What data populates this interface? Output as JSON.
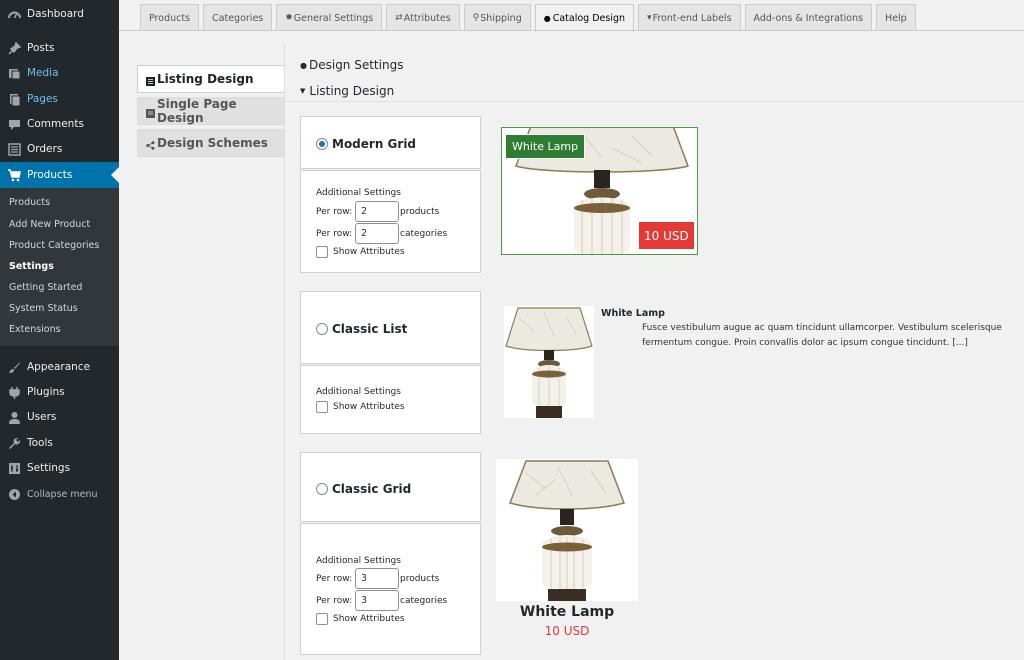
{
  "sidebar": {
    "items": [
      {
        "label": "Dashboard",
        "icon": "dashboard-icon"
      },
      {
        "label": "Posts",
        "icon": "pin-icon"
      },
      {
        "label": "Media",
        "icon": "media-icon"
      },
      {
        "label": "Pages",
        "icon": "pages-icon"
      },
      {
        "label": "Comments",
        "icon": "comment-icon"
      },
      {
        "label": "Orders",
        "icon": "orders-icon"
      },
      {
        "label": "Products",
        "icon": "cart-icon"
      },
      {
        "label": "Appearance",
        "icon": "brush-icon"
      },
      {
        "label": "Plugins",
        "icon": "plugin-icon"
      },
      {
        "label": "Users",
        "icon": "user-icon"
      },
      {
        "label": "Tools",
        "icon": "wrench-icon"
      },
      {
        "label": "Settings",
        "icon": "settings-icon"
      },
      {
        "label": "Collapse menu",
        "icon": "collapse-icon"
      }
    ],
    "submenu": [
      "Products",
      "Add New Product",
      "Product Categories",
      "Settings",
      "Getting Started",
      "System Status",
      "Extensions"
    ]
  },
  "tabs": [
    "Products",
    "Categories",
    "General Settings",
    "Attributes",
    "Shipping",
    "Catalog Design",
    "Front-end Labels",
    "Add-ons & Integrations",
    "Help"
  ],
  "subnav": [
    "Listing Design",
    "Single Page Design",
    "Design Schemes"
  ],
  "headings": {
    "design_settings": "Design Settings",
    "listing_design": "Listing Design"
  },
  "options": {
    "modern_grid": {
      "label": "Modern Grid",
      "additional": "Additional Settings",
      "per_row": "Per row:",
      "products_value": "2",
      "products_unit": "products",
      "categories_value": "2",
      "categories_unit": "categories",
      "show_attributes": "Show Attributes"
    },
    "classic_list": {
      "label": "Classic List",
      "additional": "Additional Settings",
      "show_attributes": "Show Attributes"
    },
    "classic_grid": {
      "label": "Classic Grid",
      "additional": "Additional Settings",
      "per_row": "Per row:",
      "products_value": "3",
      "products_unit": "products",
      "categories_value": "3",
      "categories_unit": "categories",
      "show_attributes": "Show Attributes"
    }
  },
  "preview": {
    "product_name": "White Lamp",
    "price": "10 USD",
    "description": "Fusce vestibulum augue ac quam tincidunt ullamcorper. Vestibulum scelerisque fermentum congue. Proin convallis dolor ac ipsum congue tincidunt. [...]"
  },
  "colors": {
    "sidebar_bg": "#23282d",
    "active_blue": "#0073aa",
    "badge_green": "#2e7d32",
    "price_red": "#e53935"
  }
}
